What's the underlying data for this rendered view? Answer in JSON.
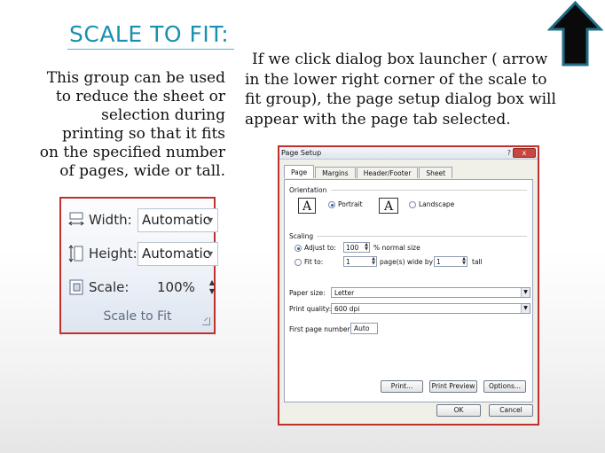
{
  "slide": {
    "title": "SCALE TO FIT:",
    "left_text": "This group can be used  to reduce the sheet or selection during printing so that it fits on the specified number of pages, wide or tall.",
    "right_text_first": "If we click dialog box launcher ( arrow",
    "right_text_rest": "in the lower right corner of the scale to fit group), the page setup dialog box will appear with the page tab selected."
  },
  "ribbon": {
    "width_label": "Width:",
    "width_value": "Automatic",
    "height_label": "Height:",
    "height_value": "Automatic",
    "scale_label": "Scale:",
    "scale_value": "100%",
    "caption": "Scale to Fit"
  },
  "dialog": {
    "title": "Page Setup",
    "help": "?",
    "close": "x",
    "tabs": [
      "Page",
      "Margins",
      "Header/Footer",
      "Sheet"
    ],
    "orientation_label": "Orientation",
    "portrait": "Portrait",
    "landscape": "Landscape",
    "orient_glyph": "A",
    "scaling_label": "Scaling",
    "adjust_to": "Adjust to:",
    "adjust_value": "100",
    "normal_size": "% normal size",
    "fit_to": "Fit to:",
    "fit_wide_value": "1",
    "pages_wide_by": "page(s) wide by",
    "fit_tall_value": "1",
    "tall": "tall",
    "paper_size_label": "Paper size:",
    "paper_size_value": "Letter",
    "print_quality_label": "Print quality:",
    "print_quality_value": "600 dpi",
    "first_page_label": "First page number:",
    "first_page_value": "Auto",
    "print_btn": "Print...",
    "preview_btn": "Print Preview",
    "options_btn": "Options...",
    "ok_btn": "OK",
    "cancel_btn": "Cancel"
  },
  "colors": {
    "title": "#1a8fb0",
    "highlight_border": "#c0302d",
    "arrow_fill": "#0a0a0a",
    "arrow_glow": "#1f6e86"
  }
}
